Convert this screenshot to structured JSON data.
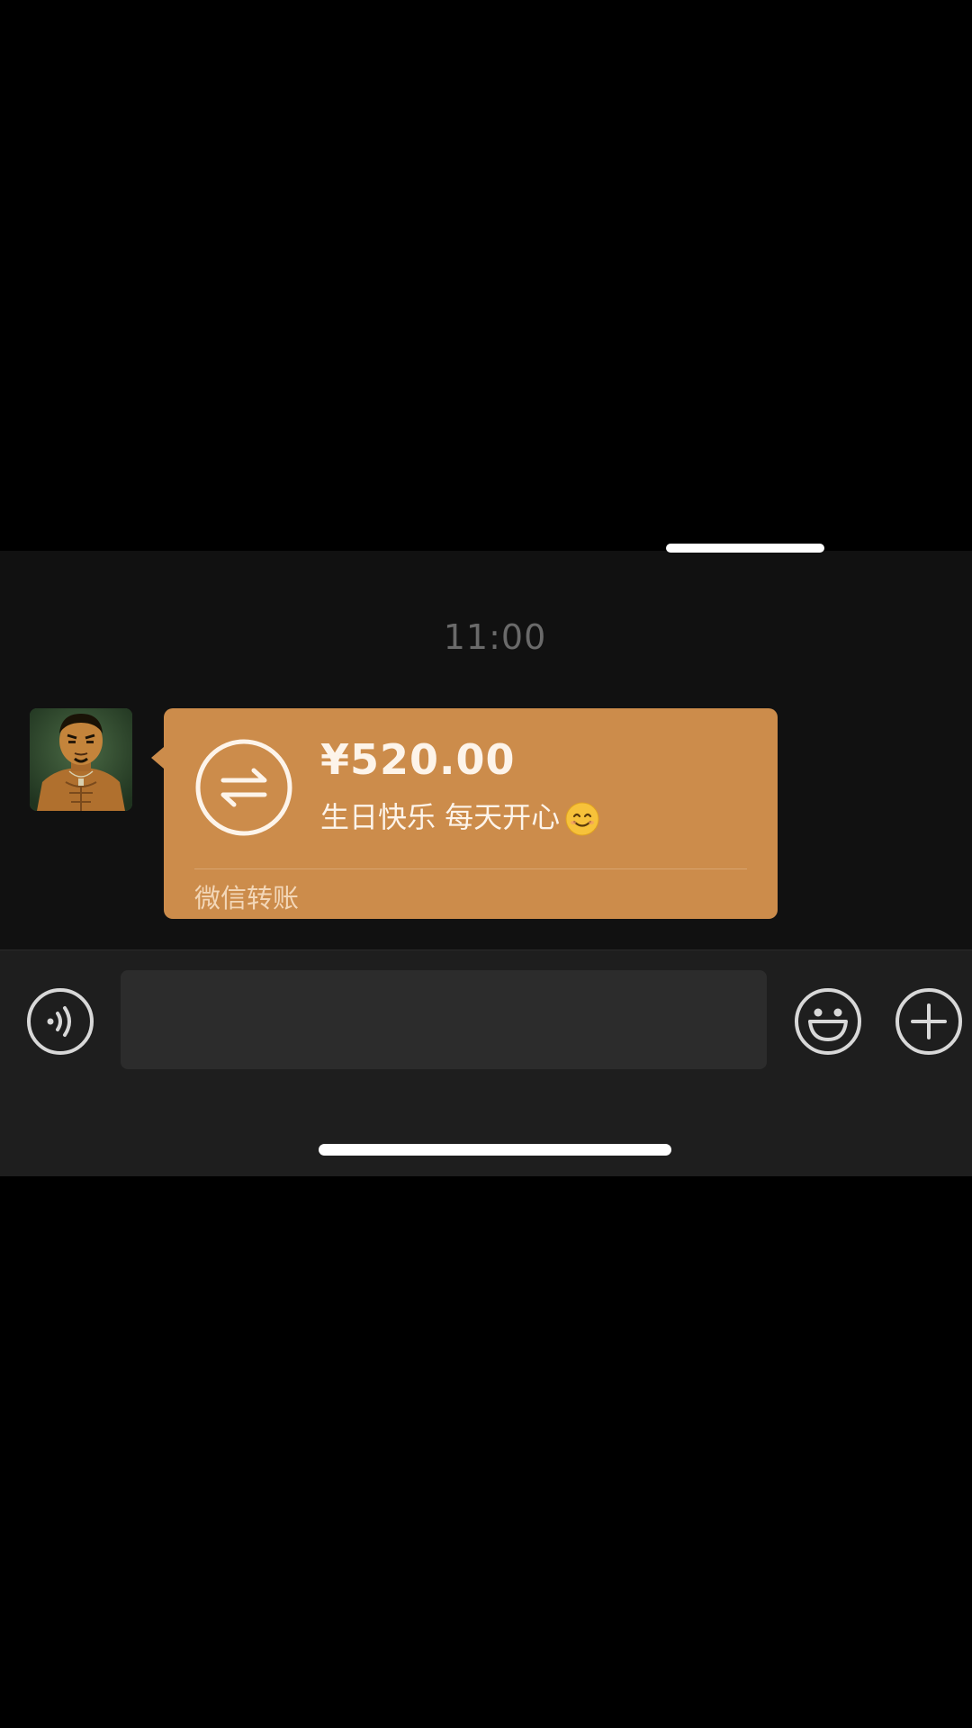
{
  "chat": {
    "timestamp": "11:00"
  },
  "transfer_message": {
    "amount": "¥520.00",
    "note": "生日快乐  每天开心",
    "note_emoji": "smiling-face-icon",
    "source_label": "微信转账",
    "bubble_color": "#cc8c4b",
    "icon": "transfer-arrows-icon"
  },
  "input_bar": {
    "voice_icon": "voice-input-icon",
    "message_value": "",
    "emoji_icon": "emoji-icon",
    "more_icon": "plus-icon"
  },
  "colors": {
    "background": "#111111",
    "input_bar": "#1e1e1e",
    "input_field": "#2c2c2c",
    "timestamp": "#6a6a6a"
  }
}
